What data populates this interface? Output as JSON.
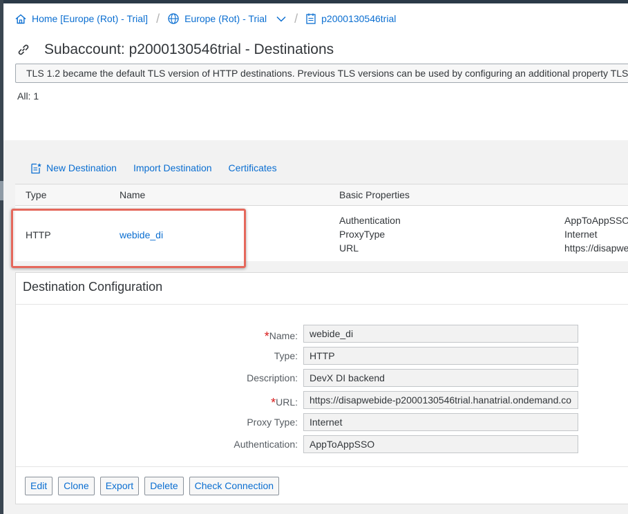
{
  "breadcrumb": {
    "home": "Home [Europe (Rot) - Trial]",
    "region": "Europe (Rot) - Trial",
    "subaccount": "p2000130546trial"
  },
  "page": {
    "title": "Subaccount: p2000130546trial - Destinations",
    "banner": "TLS 1.2 became the default TLS version of HTTP destinations. Previous TLS versions can be used by configuring an additional property TLS",
    "count": "All: 1"
  },
  "toolbar": {
    "new_destination": "New Destination",
    "import_destination": "Import Destination",
    "certificates": "Certificates"
  },
  "table": {
    "headers": {
      "type": "Type",
      "name": "Name",
      "basic_properties": "Basic Properties"
    },
    "rows": [
      {
        "type": "HTTP",
        "name": "webide_di",
        "properties": [
          {
            "key": "Authentication",
            "value": "AppToAppSSO"
          },
          {
            "key": "ProxyType",
            "value": "Internet"
          },
          {
            "key": "URL",
            "value": "https://disapwe"
          }
        ]
      }
    ]
  },
  "config": {
    "title": "Destination Configuration",
    "fields": [
      {
        "label": "Name:",
        "value": "webide_di",
        "required": true
      },
      {
        "label": "Type:",
        "value": "HTTP",
        "required": false
      },
      {
        "label": "Description:",
        "value": "DevX DI backend",
        "required": false
      },
      {
        "label": "URL:",
        "value": "https://disapwebide-p2000130546trial.hanatrial.ondemand.co",
        "required": true
      },
      {
        "label": "Proxy Type:",
        "value": "Internet",
        "required": false
      },
      {
        "label": "Authentication:",
        "value": "AppToAppSSO",
        "required": false
      }
    ],
    "required_mark": "*",
    "buttons": {
      "edit": "Edit",
      "clone": "Clone",
      "export": "Export",
      "delete": "Delete",
      "check": "Check Connection"
    }
  },
  "colors": {
    "link": "#0a6ed1",
    "highlight": "#e5685c",
    "required": "#d81b1b"
  }
}
